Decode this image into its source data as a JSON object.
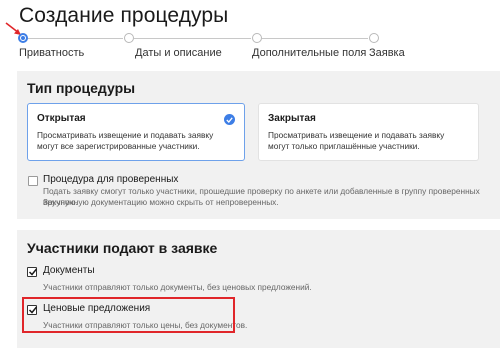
{
  "page": {
    "title": "Создание процедуры"
  },
  "stepper": {
    "steps": [
      {
        "label": "Приватность",
        "active": true
      },
      {
        "label": "Даты и описание",
        "active": false
      },
      {
        "label": "Дополнительные поля",
        "active": false
      },
      {
        "label": "Заявка",
        "active": false
      }
    ]
  },
  "procedure_type": {
    "title": "Тип процедуры",
    "open": {
      "title": "Открытая",
      "description_line1": "Просматривать извещение и подавать заявку",
      "description_line2": "могут все зарегистрированные участники.",
      "selected": true
    },
    "closed": {
      "title": "Закрытая",
      "description_line1": "Просматривать извещение и подавать заявку",
      "description_line2": "могут только приглашённые участники.",
      "selected": false
    },
    "verified_only": {
      "label": "Процедура для проверенных",
      "description_line1": "Подать заявку смогут только участники, прошедшие проверку по анкете или добавленные в группу проверенных вручную.",
      "description_line2": "Закупочную документацию можно скрыть от непроверенных.",
      "checked": false
    }
  },
  "bid_contents": {
    "title": "Участники подают в заявке",
    "documents": {
      "label": "Документы",
      "description": "Участники отправляют только документы, без ценовых предложений.",
      "checked": true
    },
    "price_offers": {
      "label": "Ценовые предложения",
      "description": "Участники отправляют только цены, без документов.",
      "checked": true
    }
  },
  "colors": {
    "accent": "#3d7ee6",
    "highlight": "#e0262a",
    "panel_bg": "#f1f1f1"
  }
}
